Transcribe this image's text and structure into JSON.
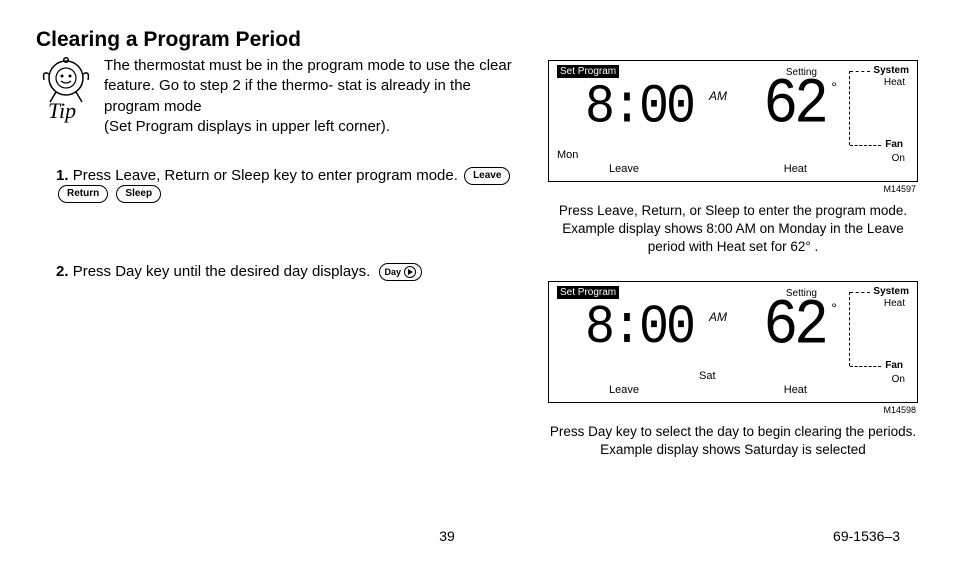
{
  "title": "Clearing a Program Period",
  "tip_line1": "The thermostat must be in the program mode to use the clear feature. Go to step 2 if the thermo-",
  "tip_line2": "stat is already in the program mode",
  "tip_line3": "(Set Program displays in upper left corner).",
  "step1_pre": "Press Leave, Return or Sleep key to enter program mode.",
  "step2": "Press Day key until the desired day displays.",
  "btn_leave": "Leave",
  "btn_return": "Return",
  "btn_sleep": "Sleep",
  "btn_day": "Day",
  "lcd": {
    "set_program": "Set Program",
    "setting": "Setting",
    "system": "System",
    "heat": "Heat",
    "fan": "Fan",
    "on": "On",
    "leave": "Leave",
    "time": "8:00",
    "am": "AM",
    "temp": "62",
    "deg": "°"
  },
  "lcd1_day": "Mon",
  "lcd2_day": "Sat",
  "fig1_id": "M14597",
  "fig2_id": "M14598",
  "caption1": "Press Leave, Return, or Sleep to enter the program mode. Example display shows 8:00 AM on Monday in the Leave period with Heat set for 62° .",
  "caption2": "Press Day key to select the day to begin clearing the periods. Example display shows Saturday is selected",
  "page_number": "39",
  "doc_number": "69-1536–3"
}
